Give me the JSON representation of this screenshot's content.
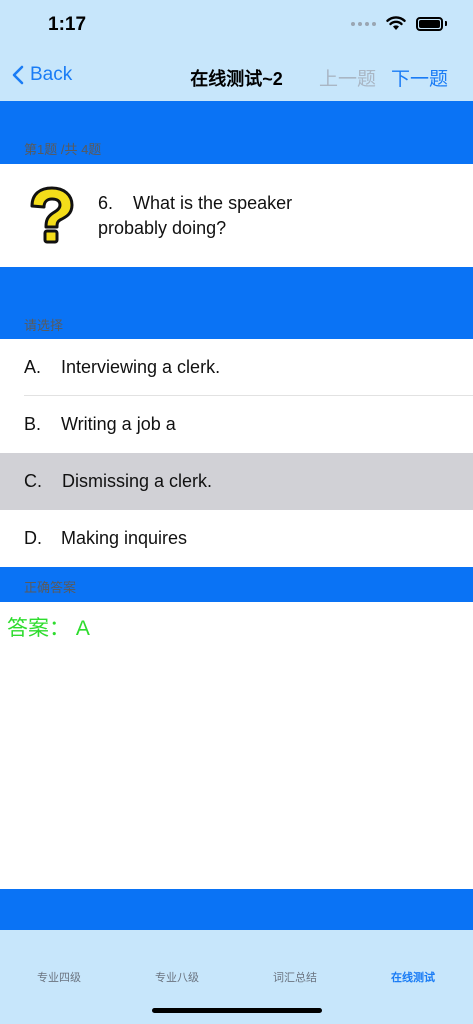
{
  "status_bar": {
    "time": "1:17"
  },
  "nav": {
    "back_label": "Back",
    "title": "在线测试~2",
    "prev_label": "上一题",
    "next_label": "下一题"
  },
  "question_header": "第1题 /共 4题",
  "question": {
    "number": "6.",
    "text": "What is the speaker probably doing?"
  },
  "options_header": "请选择",
  "options": [
    {
      "letter": "A.",
      "text": "Interviewing a clerk.",
      "selected": false
    },
    {
      "letter": "B.",
      "text": "Writing a job a",
      "selected": false
    },
    {
      "letter": "C.",
      "text": "Dismissing a clerk.",
      "selected": true
    },
    {
      "letter": "D.",
      "text": "Making inquires",
      "selected": false
    }
  ],
  "answer_header": "正确答案",
  "answer": "答案： A",
  "tabs": [
    {
      "label": "专业四级",
      "active": false
    },
    {
      "label": "专业八级",
      "active": false
    },
    {
      "label": "词汇总结",
      "active": false
    },
    {
      "label": "在线测试",
      "active": true
    }
  ],
  "colors": {
    "band_blue": "#0a73f5",
    "bar_background": "#c7e6fb",
    "accent": "#1a7cf5",
    "answer_green": "#2edc2e",
    "selected_row": "#d1d1d6"
  }
}
